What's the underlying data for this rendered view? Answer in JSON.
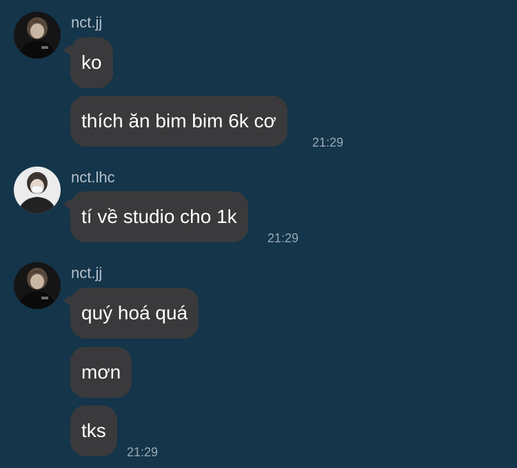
{
  "groups": [
    {
      "sender": "nct.jj",
      "messages": [
        {
          "text": "ko"
        },
        {
          "text": "thích ăn bim bim 6k cơ",
          "time": "21:29"
        }
      ]
    },
    {
      "sender": "nct.lhc",
      "messages": [
        {
          "text": "tí về studio cho 1k",
          "time": "21:29"
        }
      ]
    },
    {
      "sender": "nct.jj",
      "messages": [
        {
          "text": "quý hoá quá"
        },
        {
          "text": "mơn"
        },
        {
          "text": "tks",
          "time": "21:29"
        }
      ]
    }
  ],
  "colors": {
    "background": "#14354a",
    "bubble": "#3a3a3c",
    "text": "#ffffff",
    "sender": "#b5c1cb",
    "timestamp": "#9aaab6"
  }
}
